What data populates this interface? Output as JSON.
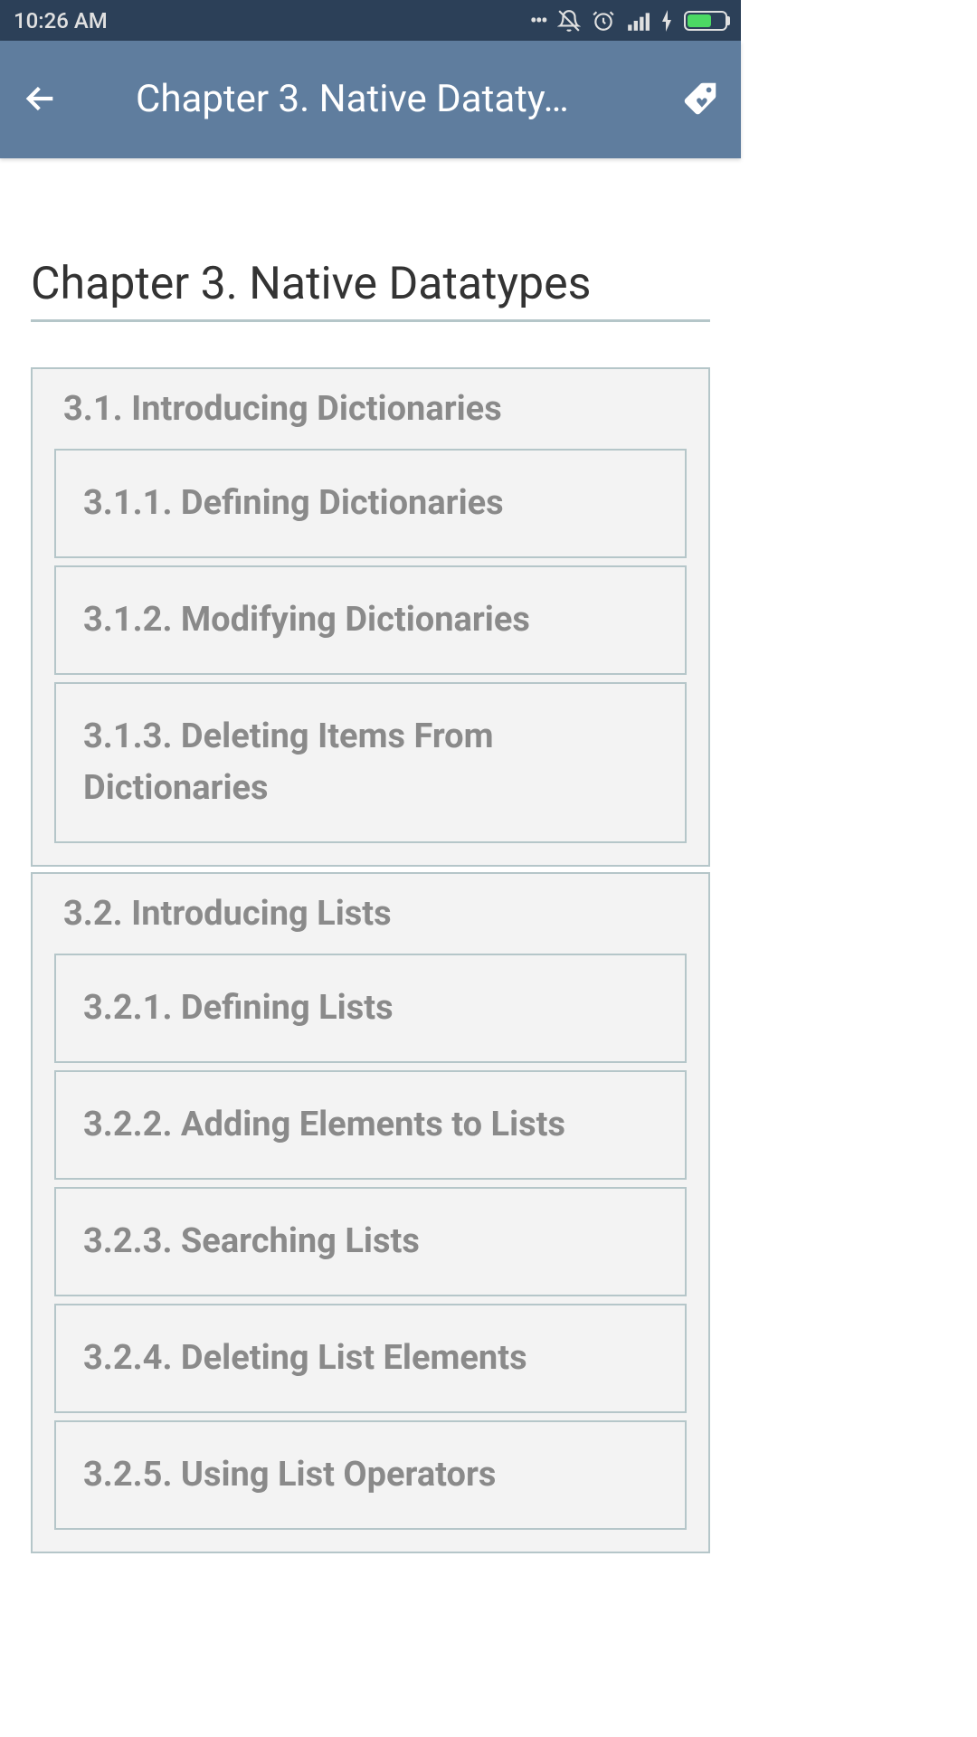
{
  "statusbar": {
    "time": "10:26 AM"
  },
  "appbar": {
    "title": "Chapter 3. Native Dataty…"
  },
  "content": {
    "title": "Chapter 3. Native Datatypes"
  },
  "sections": [
    {
      "title": "3.1. Introducing Dictionaries",
      "items": [
        "3.1.1. Defining Dictionaries",
        "3.1.2. Modifying Dictionaries",
        "3.1.3. Deleting Items From Dictionaries"
      ]
    },
    {
      "title": "3.2. Introducing Lists",
      "items": [
        "3.2.1. Defining Lists",
        "3.2.2. Adding Elements to Lists",
        "3.2.3. Searching Lists",
        "3.2.4. Deleting List Elements",
        "3.2.5. Using List Operators"
      ]
    }
  ]
}
